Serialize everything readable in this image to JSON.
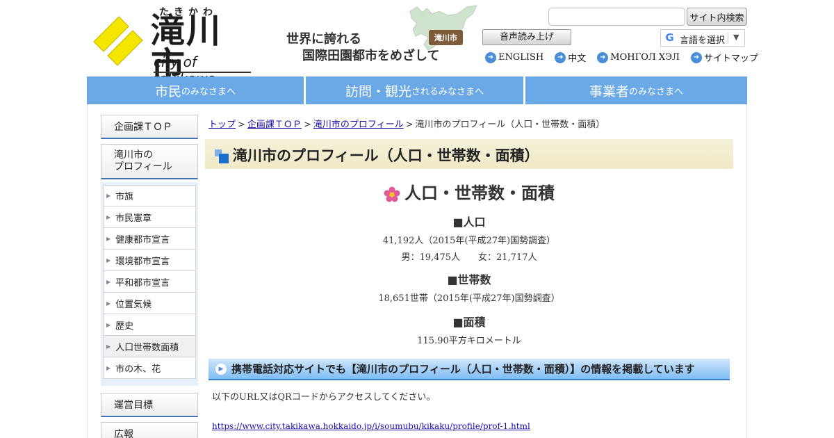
{
  "header": {
    "logo": {
      "kana": "たきかわ",
      "kanji": "滝川市",
      "english": "city of takikawa"
    },
    "tagline": {
      "line1": "世界に誇れる",
      "line2": "国際田園都市をめざして",
      "badge": "滝川市"
    },
    "search": {
      "value": "",
      "button_label": "サイト内検索"
    },
    "voice_button": "音声読み上げ",
    "language_select": "言語を選択",
    "lang_links": [
      "ENGLISH",
      "中文",
      "МОНГОЛ ХЭЛ",
      "サイトマップ"
    ]
  },
  "global_nav": [
    {
      "big": "市民",
      "small": "のみなさまへ"
    },
    {
      "big": "訪問・観光",
      "small": "されるみなさまへ"
    },
    {
      "big": "事業者",
      "small": "のみなさまへ"
    }
  ],
  "sidebar": {
    "top": "企画課ＴＯＰ",
    "profile_line1": "滝川市の",
    "profile_line2": "プロフィール",
    "items": [
      "市旗",
      "市民憲章",
      "健康都市宣言",
      "環境都市宣言",
      "平和都市宣言",
      "位置気候",
      "歴史",
      "人口世帯数面積",
      "市の木、花"
    ],
    "current_index": 7,
    "goal": "運営目標",
    "pr": "広報"
  },
  "breadcrumb": {
    "items": [
      "トップ",
      "企画課ＴＯＰ",
      "滝川市のプロフィール"
    ],
    "current": "滝川市のプロフィール（人口・世帯数・面積）",
    "separator": ">"
  },
  "main": {
    "page_title": "滝川市のプロフィール（人口・世帯数・面積）",
    "section_title": "人口・世帯数・面積",
    "population": {
      "heading": "■人口",
      "line1": "41,192人（2015年(平成27年)国勢調査）",
      "line2": "男：19,475人　　女：21,717人"
    },
    "households": {
      "heading": "■世帯数",
      "line1": "18,651世帯（2015年(平成27年)国勢調査）"
    },
    "area": {
      "heading": "■面積",
      "line1": "115.90平方キロメートル"
    },
    "mobile_heading": "携帯電話対応サイトでも【滝川市のプロフィール（人口・世帯数・面積）】の情報を掲載しています",
    "mobile_desc": "以下のURL又はQRコードからアクセスしてください。",
    "mobile_url": "https://www.city.takikawa.hokkaido.jp/i/soumubu/kikaku/profile/prof-1.html"
  },
  "colors": {
    "nav_blue": "#6aa9e6",
    "sidebar_rule": "#3f74b0",
    "title_bar": "#f2edcf",
    "logo_yellow": "#f5e600"
  },
  "icons": {
    "logo": "logo-emblem-icon",
    "map": "hokkaido-map-icon",
    "lang": "arrow-circle-icon",
    "section": "cosmos-flower-icon",
    "mobile": "play-circle-icon"
  }
}
